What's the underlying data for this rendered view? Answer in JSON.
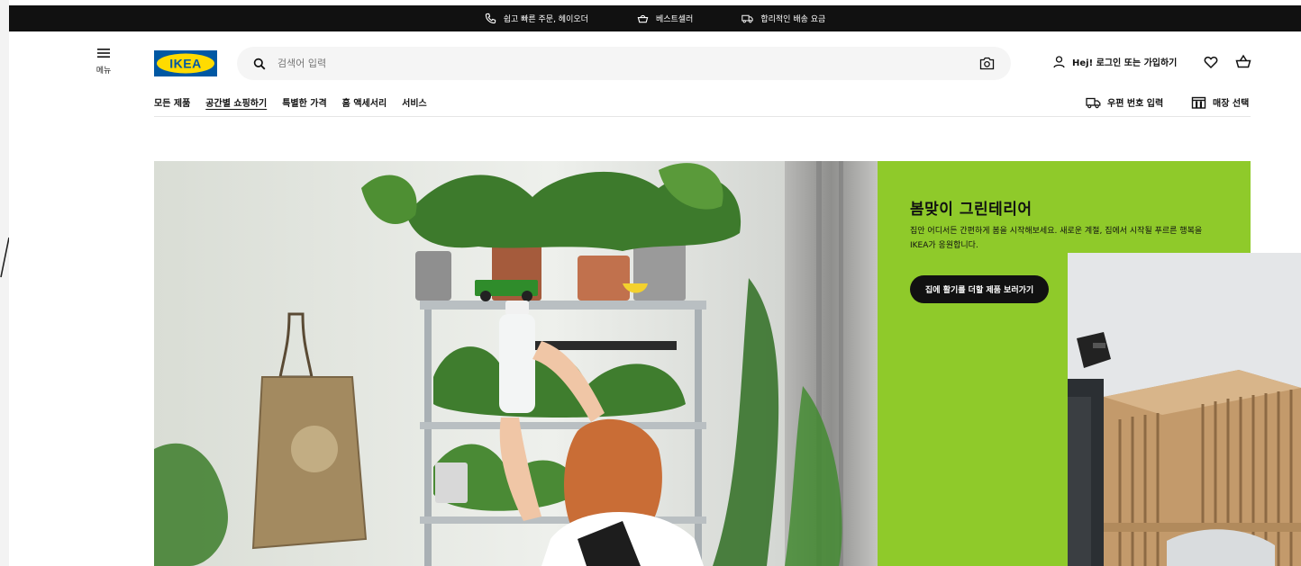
{
  "topbar": {
    "items": [
      {
        "icon": "phone-icon",
        "label": "쉽고 빠른 주문, 헤이오더"
      },
      {
        "icon": "bag-icon",
        "label": "베스트셀러"
      },
      {
        "icon": "truck-icon",
        "label": "합리적인 배송 요금"
      }
    ]
  },
  "header": {
    "menu_label": "메뉴",
    "logo_text": "IKEA",
    "search_placeholder": "검색어 입력",
    "account_label": "Hej! 로그인 또는 가입하기"
  },
  "nav": {
    "items": [
      {
        "label": "모든 제품",
        "active": false
      },
      {
        "label": "공간별 쇼핑하기",
        "active": true
      },
      {
        "label": "특별한 가격",
        "active": false
      },
      {
        "label": "홈 액세서리",
        "active": false
      },
      {
        "label": "서비스",
        "active": false
      }
    ],
    "postal_label": "우편 번호 입력",
    "store_label": "매장 선택"
  },
  "hero": {
    "title": "봄맞이 그린테리어",
    "description": "집안 어디서든 간편하게 봄을 시작해보세요. 새로운 계절, 집에서 시작될 푸르른 행복을 IKEA가 응원합니다.",
    "cta_label": "집에 활기를 더할 제품 보러가기",
    "panel_color": "#8fca2a"
  },
  "colors": {
    "topbar": "#111111",
    "logo_blue": "#0058a3",
    "logo_yellow": "#ffdb00",
    "search_bg": "#f5f5f5"
  }
}
